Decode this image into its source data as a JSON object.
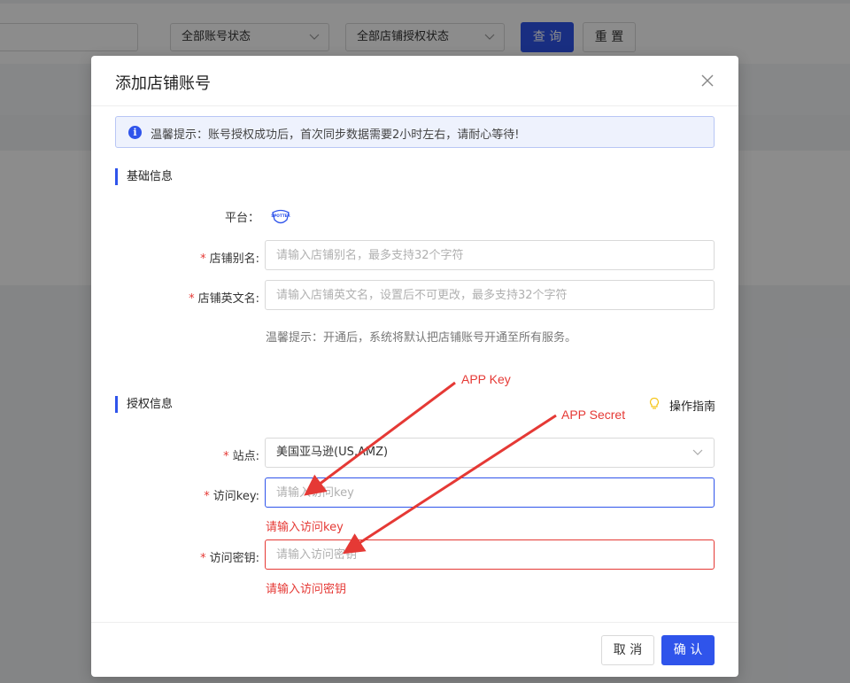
{
  "background": {
    "search_input_value": "",
    "account_status_select": "全部账号状态",
    "auth_status_select": "全部店铺授权状态",
    "query_button": "查 询",
    "reset_button": "重 置"
  },
  "modal": {
    "title": "添加店铺账号",
    "close_glyph": "×",
    "tip": "温馨提示：账号授权成功后，首次同步数据需要2小时左右，请耐心等待!",
    "tip_icon_glyph": "i",
    "basic_section": "基础信息",
    "platform_label": "平台：",
    "platform_logo_text": "SPOTTER",
    "required_mark": "*",
    "alias_label": "店铺别名:",
    "alias_placeholder": "请输入店铺别名，最多支持32个字符",
    "english_name_label": "店铺英文名:",
    "english_name_placeholder": "请输入店铺英文名，设置后不可更改，最多支持32个字符",
    "service_hint": "温馨提示：开通后，系统将默认把店铺账号开通至所有服务。",
    "auth_section": "授权信息",
    "guide_link": "操作指南",
    "site_label": "站点:",
    "site_value": "美国亚马逊(US,AMZ)",
    "access_key_label": "访问key:",
    "access_key_placeholder": "请输入访问key",
    "access_key_error": "请输入访问key",
    "secret_label": "访问密钥:",
    "secret_placeholder": "请输入访问密钥",
    "secret_error": "请输入访问密钥",
    "cancel_button": "取 消",
    "confirm_button": "确 认"
  },
  "annotations": {
    "app_key": "APP Key",
    "app_secret": "APP Secret"
  },
  "icons": {
    "chevron": "chevron-down-icon",
    "info": "info-icon",
    "close": "close-icon",
    "bulb": "lightbulb-icon"
  },
  "colors": {
    "primary": "#2f54eb",
    "error": "#e53935",
    "annotation": "#e53935"
  }
}
